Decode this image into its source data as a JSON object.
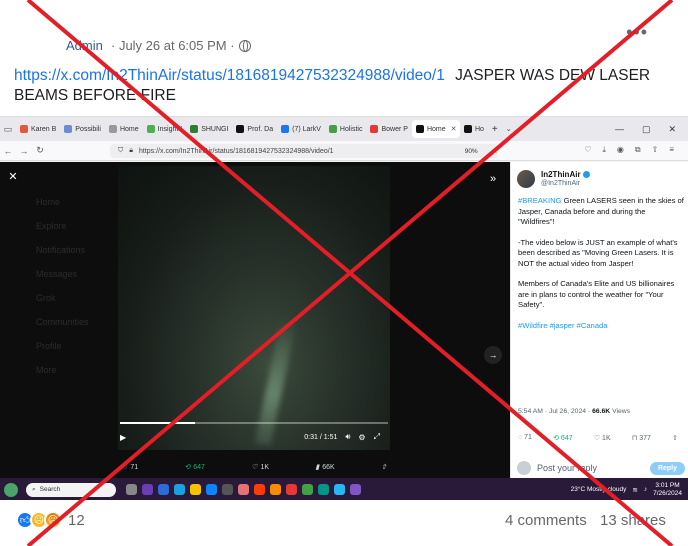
{
  "post": {
    "author": "Admin",
    "meta": "· July 26 at 6:05 PM ·",
    "link_text": "https://x.com/In2ThinAir/status/1816819427532324988/video/1",
    "caption": "JASPER WAS DEW LASER BEAMS BEFORE FIRE"
  },
  "browser": {
    "tabs": [
      {
        "label": "Karen B",
        "color": "#e2583e"
      },
      {
        "label": "Possibili",
        "color": "#6a8dd6"
      },
      {
        "label": "Home",
        "color": "#999999"
      },
      {
        "label": "Insight I",
        "color": "#4caf50"
      },
      {
        "label": "SHUNGI",
        "color": "#2e7d32"
      },
      {
        "label": "Prof. Da",
        "color": "#111111"
      },
      {
        "label": "(7) LarkV",
        "color": "#1877f2"
      },
      {
        "label": "Holistic",
        "color": "#43a047"
      },
      {
        "label": "Bower P",
        "color": "#e53935"
      },
      {
        "label": "Home",
        "color": "#111111"
      },
      {
        "label": "Ho",
        "color": "#111111"
      }
    ],
    "url": "https://x.com/In2ThinAir/status/1816819427532324988/video/1",
    "zoom": "90%"
  },
  "x_page": {
    "sidebar": [
      "Home",
      "Explore",
      "Notifications",
      "Messages",
      "Grok",
      "Communities",
      "Profile",
      "More"
    ],
    "video_time": "0:31 / 1:51",
    "video_progress": 0.28,
    "actions": {
      "replies": "71",
      "reposts": "647",
      "likes": "1K",
      "views": "66K"
    }
  },
  "tweet": {
    "name": "In2ThinAir",
    "handle": "@In2ThinAir",
    "p1_tag": "#BREAKING",
    "p1_text": " Green LASERS seen in the skies of Jasper, Canada before and during the \"Wildfires\"!",
    "p2": "-The video below is JUST an example of what's been described as \"Moving Green Lasers. It is NOT the actual video from Jasper!",
    "p3": "Members of Canada's Elite and US billionaires are in plans to control the weather for \"Your Safety\".",
    "tags": "#Wildfire #jasper #Canada",
    "timestamp": "5:54 AM · Jul 26, 2024 · ",
    "views": "66.6K",
    "views_label": " Views",
    "stats": {
      "replies": "71",
      "reposts": "647",
      "likes": "1K",
      "bookmarks": "377"
    },
    "reply_placeholder": "Post your reply",
    "reply_button": "Reply"
  },
  "taskbar": {
    "search": "Search",
    "weather": "23°C Mostly cloudy",
    "time": "3:01 PM",
    "date": "7/26/2024"
  },
  "footer": {
    "reaction_count": "12",
    "comments": "4 comments",
    "shares": "13 shares"
  },
  "colors": {
    "overlay_cross": "#e41e26",
    "link": "#1a73e8",
    "twitter_blue": "#1d9bf0"
  }
}
